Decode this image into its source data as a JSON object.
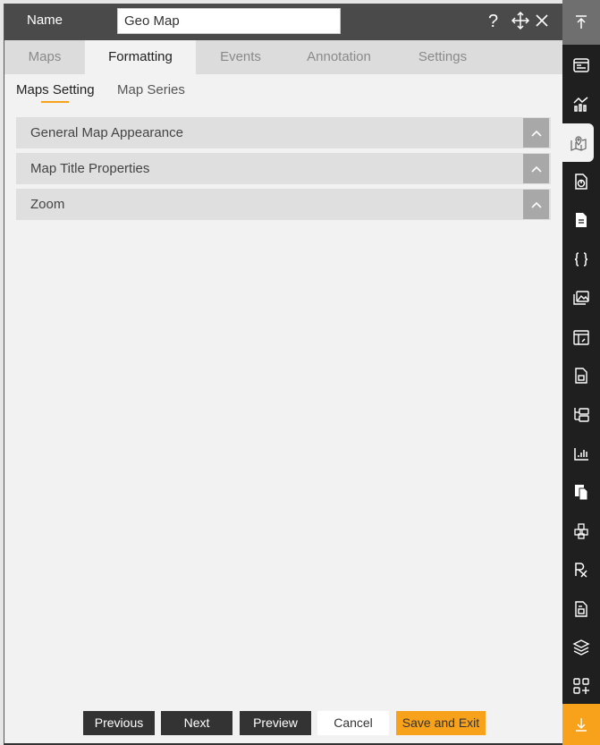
{
  "header": {
    "name_label": "Name",
    "name_value": "Geo Map",
    "help_icon": "question-icon",
    "move_icon": "move-icon",
    "close_icon": "close-icon"
  },
  "tabs": [
    {
      "label": "Maps",
      "active": false
    },
    {
      "label": "Formatting",
      "active": true
    },
    {
      "label": "Events",
      "active": false
    },
    {
      "label": "Annotation",
      "active": false
    },
    {
      "label": "Settings",
      "active": false
    }
  ],
  "subtabs": [
    {
      "label": "Maps Setting",
      "active": true
    },
    {
      "label": "Map Series",
      "active": false
    }
  ],
  "sections": [
    {
      "title": "General Map Appearance",
      "icon": "chevron-up-icon"
    },
    {
      "title": "Map Title Properties",
      "icon": "chevron-up-icon"
    },
    {
      "title": "Zoom",
      "icon": "chevron-up-icon"
    }
  ],
  "footer": {
    "previous": "Previous",
    "next": "Next",
    "preview": "Preview",
    "cancel": "Cancel",
    "save_exit": "Save and Exit"
  },
  "sidebar": {
    "top_icon": "scroll-top-icon",
    "items": [
      "table-icon",
      "chart-icon",
      "map-icon",
      "pie-report-icon",
      "document-icon",
      "code-braces-icon",
      "image-icon",
      "calendar-icon",
      "calculator-icon",
      "tree-icon",
      "bar-chart-icon",
      "copy-icon",
      "cubes-icon",
      "rx-icon",
      "form-icon",
      "layers-icon",
      "add-widget-icon"
    ],
    "active_item": "map-icon",
    "bottom_icon": "scroll-bottom-icon"
  },
  "colors": {
    "accent": "#f7a21a",
    "header_bg": "#4a4a4a",
    "sidebar_bg": "#1f1f1f",
    "panel_bg": "#f2f2f2"
  }
}
